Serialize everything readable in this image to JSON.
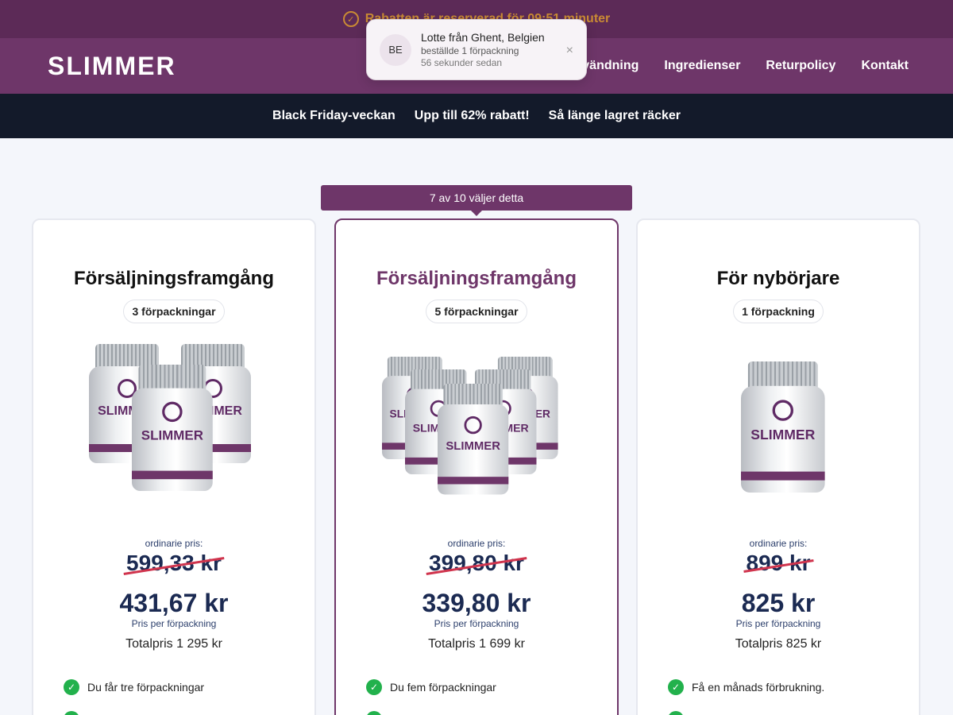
{
  "topbar": {
    "icon": "discount-badge-icon",
    "text": "Rabatten är reserverad för 09:51 minuter"
  },
  "nav": {
    "logo": "SLIMMER",
    "items": [
      "Användning",
      "Ingredienser",
      "Returpolicy",
      "Kontakt"
    ]
  },
  "promo": {
    "items": [
      "Black Friday-veckan",
      "Upp till 62% rabatt!",
      "Så länge lagret räcker"
    ]
  },
  "toast": {
    "initials": "BE",
    "who": "Lotte från Ghent, Belgien",
    "what": "beställde 1 förpackning",
    "when": "56 sekunder sedan",
    "close": "×"
  },
  "popular_label": "7 av 10 väljer detta",
  "cards": [
    {
      "title": "Försäljningsframgång",
      "pill": "3 förpackningar",
      "bottle_count": 3,
      "regular_label": "ordinarie pris:",
      "old_price": "599,33 kr",
      "new_price": "431,67 kr",
      "per_unit_label": "Pris per förpackning",
      "total": "Totalpris 1 295 kr",
      "features": [
        "Du får tre förpackningar",
        ""
      ]
    },
    {
      "title": "Försäljningsframgång",
      "pill": "5 förpackningar",
      "bottle_count": 5,
      "regular_label": "ordinarie pris:",
      "old_price": "399,80 kr",
      "new_price": "339,80 kr",
      "per_unit_label": "Pris per förpackning",
      "total": "Totalpris 1 699 kr",
      "features": [
        "Du fem förpackningar",
        ""
      ]
    },
    {
      "title": "För nybörjare",
      "pill": "1 förpackning",
      "bottle_count": 1,
      "regular_label": "ordinarie pris:",
      "old_price": "899 kr",
      "new_price": "825 kr",
      "per_unit_label": "Pris per förpackning",
      "total": "Totalpris 825 kr",
      "features": [
        "Få en månads förbrukning.",
        ""
      ]
    }
  ],
  "bottle_label": "SLIMMER",
  "colors": {
    "brand": "#6e3669",
    "topbar": "#5c2a57",
    "accent": "#c98a34",
    "price": "#1b2a52",
    "check": "#22b14c",
    "strike": "#d0344d"
  }
}
